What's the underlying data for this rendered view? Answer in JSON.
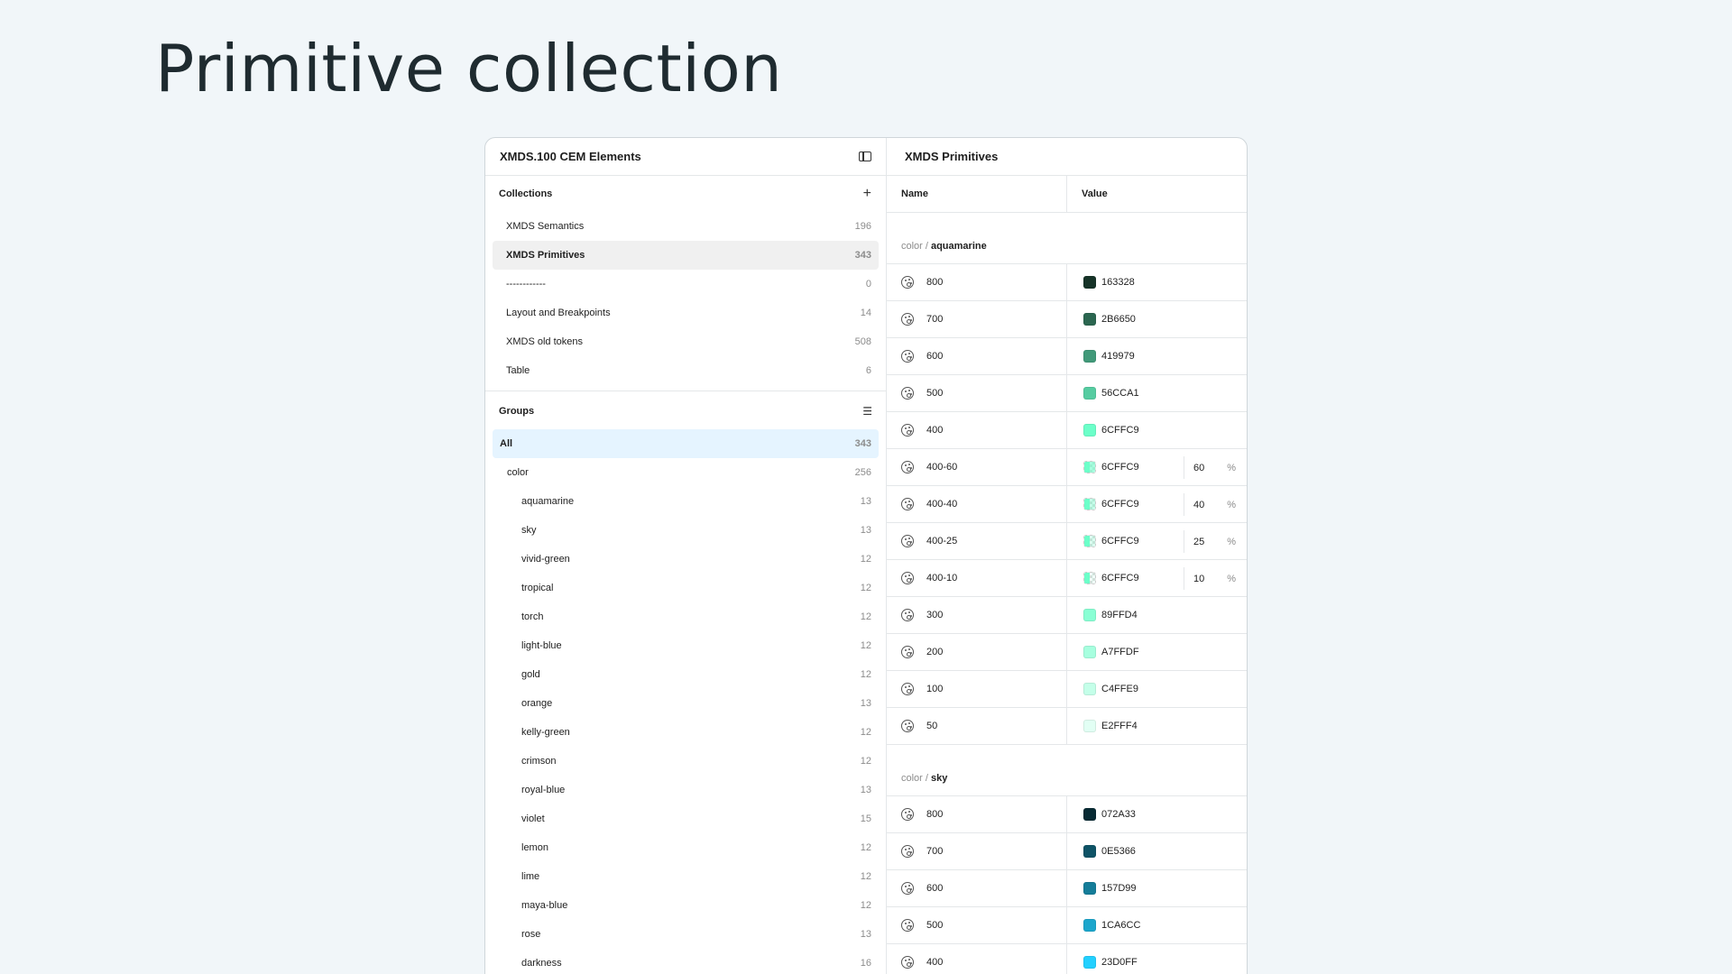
{
  "page_title": "Primitive collection",
  "left_panel": {
    "title": "XMDS.100 CEM Elements",
    "collections_label": "Collections",
    "collections": [
      {
        "label": "XMDS Semantics",
        "count": "196"
      },
      {
        "label": "XMDS Primitives",
        "count": "343"
      },
      {
        "label": "------------",
        "count": "0"
      },
      {
        "label": "Layout and Breakpoints",
        "count": "14"
      },
      {
        "label": "XMDS old tokens",
        "count": "508"
      },
      {
        "label": "Table",
        "count": "6"
      }
    ],
    "groups_label": "Groups",
    "groups": [
      {
        "label": "All",
        "count": "343"
      },
      {
        "label": "color",
        "count": "256"
      },
      {
        "label": "aquamarine",
        "count": "13"
      },
      {
        "label": "sky",
        "count": "13"
      },
      {
        "label": "vivid-green",
        "count": "12"
      },
      {
        "label": "tropical",
        "count": "12"
      },
      {
        "label": "torch",
        "count": "12"
      },
      {
        "label": "light-blue",
        "count": "12"
      },
      {
        "label": "gold",
        "count": "12"
      },
      {
        "label": "orange",
        "count": "13"
      },
      {
        "label": "kelly-green",
        "count": "12"
      },
      {
        "label": "crimson",
        "count": "12"
      },
      {
        "label": "royal-blue",
        "count": "13"
      },
      {
        "label": "violet",
        "count": "15"
      },
      {
        "label": "lemon",
        "count": "12"
      },
      {
        "label": "lime",
        "count": "12"
      },
      {
        "label": "maya-blue",
        "count": "12"
      },
      {
        "label": "rose",
        "count": "13"
      },
      {
        "label": "darkness",
        "count": "16"
      }
    ]
  },
  "right_panel": {
    "title": "XMDS Primitives",
    "col_name": "Name",
    "col_value": "Value",
    "groups": [
      {
        "prefix": "color /",
        "name": "aquamarine",
        "rows": [
          {
            "name": "800",
            "hex": "163328",
            "color": "#163328"
          },
          {
            "name": "700",
            "hex": "2B6650",
            "color": "#2B6650"
          },
          {
            "name": "600",
            "hex": "419979",
            "color": "#419979"
          },
          {
            "name": "500",
            "hex": "56CCA1",
            "color": "#56CCA1"
          },
          {
            "name": "400",
            "hex": "6CFFC9",
            "color": "#6CFFC9"
          },
          {
            "name": "400-60",
            "hex": "6CFFC9",
            "color": "#6CFFC9",
            "alpha": "60",
            "pct": "%"
          },
          {
            "name": "400-40",
            "hex": "6CFFC9",
            "color": "#6CFFC9",
            "alpha": "40",
            "pct": "%"
          },
          {
            "name": "400-25",
            "hex": "6CFFC9",
            "color": "#6CFFC9",
            "alpha": "25",
            "pct": "%"
          },
          {
            "name": "400-10",
            "hex": "6CFFC9",
            "color": "#6CFFC9",
            "alpha": "10",
            "pct": "%"
          },
          {
            "name": "300",
            "hex": "89FFD4",
            "color": "#89FFD4"
          },
          {
            "name": "200",
            "hex": "A7FFDF",
            "color": "#A7FFDF"
          },
          {
            "name": "100",
            "hex": "C4FFE9",
            "color": "#C4FFE9"
          },
          {
            "name": "50",
            "hex": "E2FFF4",
            "color": "#E2FFF4"
          }
        ]
      },
      {
        "prefix": "color /",
        "name": "sky",
        "rows": [
          {
            "name": "800",
            "hex": "072A33",
            "color": "#072A33"
          },
          {
            "name": "700",
            "hex": "0E5366",
            "color": "#0E5366"
          },
          {
            "name": "600",
            "hex": "157D99",
            "color": "#157D99"
          },
          {
            "name": "500",
            "hex": "1CA6CC",
            "color": "#1CA6CC"
          },
          {
            "name": "400",
            "hex": "23D0FF",
            "color": "#23D0FF"
          }
        ]
      }
    ]
  }
}
